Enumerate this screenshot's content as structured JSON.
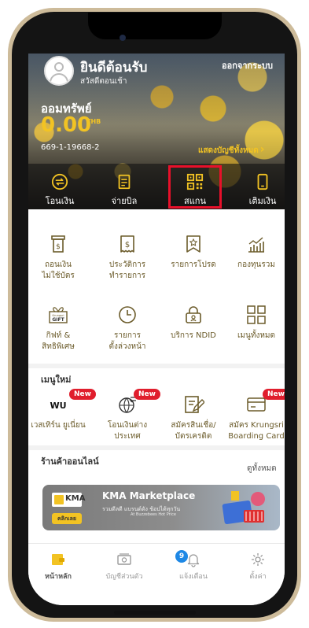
{
  "header": {
    "welcome": "ยินดีต้อนรับ",
    "greeting": "สวัสดีตอนเช้า",
    "logout": "ออกจากระบบ"
  },
  "account": {
    "label": "ออมทรัพย์",
    "balance": "0.00",
    "currency": "THB",
    "number": "669-1-19668-2",
    "show_all": "แสดงบัญชีทั้งหมด"
  },
  "quick_actions": [
    {
      "label": "โอนเงิน",
      "icon": "transfer-icon"
    },
    {
      "label": "จ่ายบิล",
      "icon": "bill-icon"
    },
    {
      "label": "สแกน",
      "icon": "qr-scan-icon"
    },
    {
      "label": "เติมเงิน",
      "icon": "mobile-topup-icon"
    }
  ],
  "menu": [
    {
      "line1": "ถอนเงิน",
      "line2": "ไม่ใช้บัตร",
      "icon": "cardless-withdraw-icon"
    },
    {
      "line1": "ประวัติการ",
      "line2": "ทำรายการ",
      "icon": "history-icon"
    },
    {
      "line1": "รายการโปรด",
      "line2": "",
      "icon": "favorite-icon"
    },
    {
      "line1": "กองทุนรวม",
      "line2": "",
      "icon": "mutual-fund-icon"
    },
    {
      "line1": "กิฟท์ &",
      "line2": "สิทธิพิเศษ",
      "icon": "gift-icon",
      "gift_text": "GIFT",
      "gift_brand": "Krungsri"
    },
    {
      "line1": "รายการ",
      "line2": "ตั้งล่วงหน้า",
      "icon": "clock-icon"
    },
    {
      "line1": "บริการ NDID",
      "line2": "",
      "icon": "ndid-icon"
    },
    {
      "line1": "เมนูทั้งหมด",
      "line2": "",
      "icon": "all-menu-icon"
    }
  ],
  "new_menu": {
    "title": "เมนูใหม่",
    "badge": "New",
    "items": [
      {
        "line1": "เวสเทิร์น ยูเนี่ยน",
        "line2": "",
        "icon": "western-union-icon",
        "logo": "WU",
        "new": true
      },
      {
        "line1": "โอนเงินต่าง",
        "line2": "ประเทศ",
        "icon": "global-transfer-icon",
        "new": true
      },
      {
        "line1": "สมัครสินเชื่อ/",
        "line2": "บัตรเครดิต",
        "icon": "loan-apply-icon",
        "new": false
      },
      {
        "line1": "สมัคร Krungsri",
        "line2": "Boarding Card",
        "icon": "boarding-card-icon",
        "new": true
      }
    ]
  },
  "shop": {
    "title": "ร้านค้าออนไลน์",
    "see_all": "ดูทั้งหมด",
    "banner_title": "KMA Marketplace",
    "banner_sub": "รวมดีลดี แบรนด์ดัง ช้อปได้ทุกวัน",
    "banner_sub2": "At Buzzebees Hot Price",
    "banner_btn": "คลิกเลย",
    "banner_logo": "KMA"
  },
  "bottom_nav": [
    {
      "label": "หน้าหลัก",
      "icon": "home-wallet-icon",
      "active": true
    },
    {
      "label": "บัญชีส่วนตัว",
      "icon": "account-icon",
      "active": false
    },
    {
      "label": "แจ้งเตือน",
      "icon": "bell-icon",
      "active": false,
      "badge": "9"
    },
    {
      "label": "ตั้งค่า",
      "icon": "gear-icon",
      "active": false
    }
  ],
  "colors": {
    "accent_yellow": "#f2c323",
    "menu_text": "#6b5b2a",
    "new_badge": "#e01e2d",
    "notify_badge": "#1e88e5",
    "highlight": "#e8102a"
  }
}
